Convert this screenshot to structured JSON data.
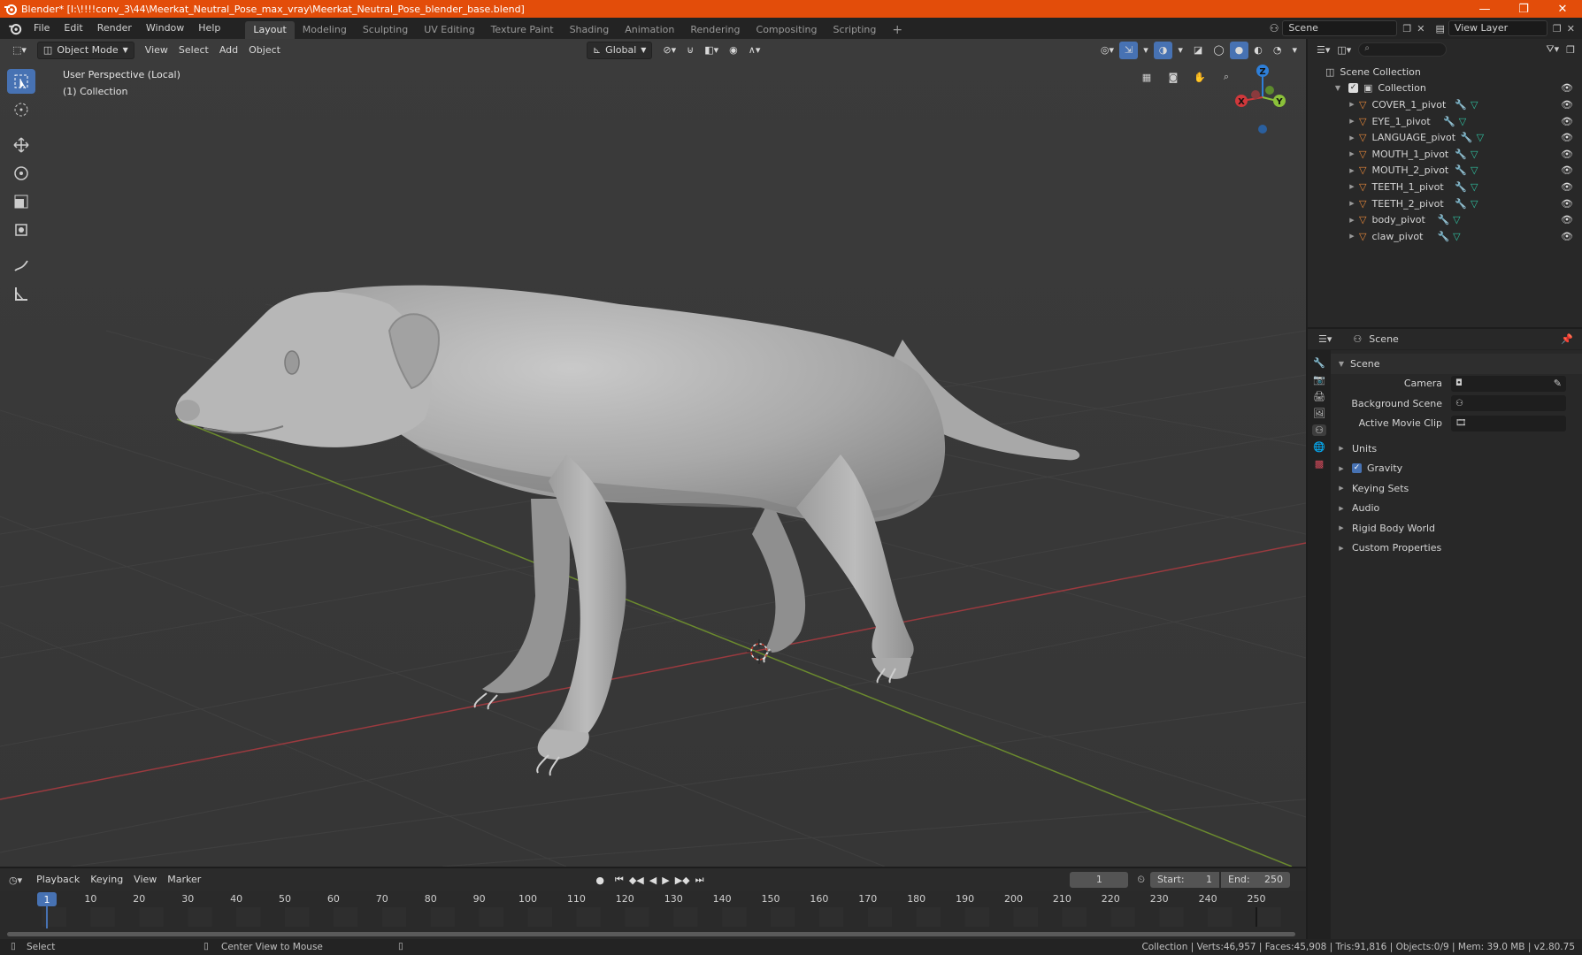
{
  "window": {
    "title": "Blender* [I:\\!!!!conv_3\\44\\Meerkat_Neutral_Pose_max_vray\\Meerkat_Neutral_Pose_blender_base.blend]",
    "minimize": "—",
    "maximize": "❐",
    "close": "✕"
  },
  "menu": {
    "items": [
      "File",
      "Edit",
      "Render",
      "Window",
      "Help"
    ]
  },
  "workspaces": {
    "tabs": [
      "Layout",
      "Modeling",
      "Sculpting",
      "UV Editing",
      "Texture Paint",
      "Shading",
      "Animation",
      "Rendering",
      "Compositing",
      "Scripting"
    ],
    "active": "Layout",
    "add": "+"
  },
  "scene_selector": {
    "value": "Scene"
  },
  "view_layer": {
    "value": "View Layer"
  },
  "viewport_header": {
    "mode": "Object Mode",
    "menus": [
      "View",
      "Select",
      "Add",
      "Object"
    ],
    "orientation": "Global"
  },
  "viewport": {
    "perspective_label": "User Perspective (Local)",
    "collection_label": "(1) Collection",
    "gizmo": {
      "x": "X",
      "y": "Y",
      "z": "Z"
    }
  },
  "outliner": {
    "root": "Scene Collection",
    "collection": "Collection",
    "objects": [
      "COVER_1_pivot",
      "EYE_1_pivot",
      "LANGUAGE_pivot",
      "MOUTH_1_pivot",
      "MOUTH_2_pivot",
      "TEETH_1_pivot",
      "TEETH_2_pivot",
      "body_pivot",
      "claw_pivot"
    ]
  },
  "properties": {
    "header": "Scene",
    "panel_title": "Scene",
    "fields": [
      {
        "label": "Camera",
        "value": ""
      },
      {
        "label": "Background Scene",
        "value": ""
      },
      {
        "label": "Active Movie Clip",
        "value": ""
      }
    ],
    "sections": [
      {
        "label": "Units",
        "checkbox": false
      },
      {
        "label": "Gravity",
        "checkbox": true
      },
      {
        "label": "Keying Sets",
        "checkbox": false
      },
      {
        "label": "Audio",
        "checkbox": false
      },
      {
        "label": "Rigid Body World",
        "checkbox": false
      },
      {
        "label": "Custom Properties",
        "checkbox": false
      }
    ]
  },
  "timeline": {
    "menus": [
      "Playback",
      "Keying",
      "View",
      "Marker"
    ],
    "current_frame": "1",
    "start_label": "Start:",
    "start_value": "1",
    "end_label": "End:",
    "end_value": "250",
    "ruler": [
      "1",
      "10",
      "20",
      "30",
      "40",
      "50",
      "60",
      "70",
      "80",
      "90",
      "100",
      "110",
      "120",
      "130",
      "140",
      "150",
      "160",
      "170",
      "180",
      "190",
      "200",
      "210",
      "220",
      "230",
      "240",
      "250"
    ]
  },
  "statusbar": {
    "select": "Select",
    "center": "Center View to Mouse",
    "stats": "Collection | Verts:46,957 | Faces:45,908 | Tris:91,816 | Objects:0/9 | Mem: 39.0 MB | v2.80.75"
  },
  "colors": {
    "titlebar": "#e34d0a",
    "accent": "#4772b3",
    "viewport_bg": "#393939",
    "panel_bg": "#282828",
    "x_axis": "#d0383b",
    "y_axis": "#8bc13a",
    "z_axis": "#2e7fd9",
    "object_icon": "#e8883a",
    "mesh_icon": "#2fc0a0",
    "modifier_icon": "#6a9bd8"
  }
}
